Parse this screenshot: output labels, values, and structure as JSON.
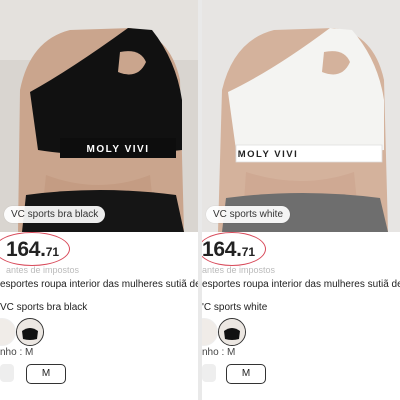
{
  "products": [
    {
      "image_caption": "VC sports bra black",
      "band_text": "MOLY VIVI",
      "price_int": "164.",
      "price_dec": "71",
      "tax_note": "antes de impostos",
      "title": "esportes roupa interior das mulheres sutiã de fitn...",
      "variant": "VC sports bra black",
      "size_label": "nho : M",
      "size_value": "M",
      "colors": {
        "garment": "#111111",
        "band": "#0d0d0d",
        "band_text": "#ffffff",
        "background": "#d8d4cf"
      }
    },
    {
      "image_caption": "VC sports white",
      "band_text": "MOLY VIVI",
      "price_int": "164.",
      "price_dec": "71",
      "tax_note": "antes de impostos",
      "title": "esportes roupa interior das mulheres sutiã de fitn...",
      "variant": "'C sports white",
      "size_label": "nho : M",
      "size_value": "M",
      "colors": {
        "garment": "#f4f4f2",
        "band": "#ffffff",
        "band_text": "#222222",
        "background": "#e6e4e2"
      }
    }
  ],
  "accent_color": "#d84a5a"
}
